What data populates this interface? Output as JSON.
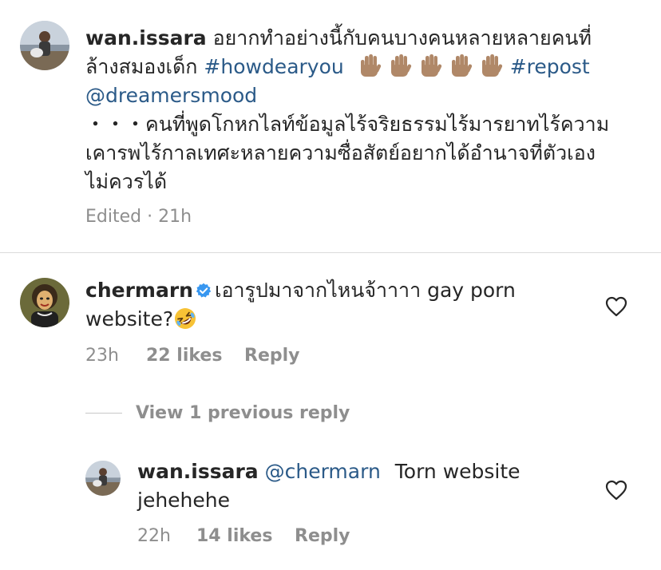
{
  "caption": {
    "username": "wan.issara",
    "text_line1": "อยากทำอย่างนี้กับคนบางคนหลายหลายคนที่",
    "text_line2_prefix": "ล้างสมองเด็ก",
    "hashtag1": "#howdearyou",
    "hand_emoji_count": 5,
    "hashtag2": "#repost",
    "mention": "@dreamersmood",
    "body_line1": "・・・คนที่พูดโกหกไลท์ข้อมูลไร้จริยธรรมไร้มารยาทไร้ความ",
    "body_line2": "เคารพไร้กาลเทศะหลายความซื่อสัตย์อยากได้อำนาจที่ตัวเอง",
    "body_line3": "ไม่ควรได้",
    "meta": "Edited · 21h"
  },
  "comment1": {
    "username": "chermarn",
    "verified": true,
    "text_line1": "เอารูปมาจากไหนจ้าาาา gay porn",
    "text_line2": "website?",
    "emoji": "rolling-on-floor-laughing",
    "time": "23h",
    "likes": "22 likes",
    "reply_label": "Reply"
  },
  "view_replies_label": "View 1 previous reply",
  "reply1": {
    "username": "wan.issara",
    "mention": "@chermarn",
    "text_line1": "Torn website",
    "text_line2": "jehehehe",
    "time": "22h",
    "likes": "14 likes",
    "reply_label": "Reply"
  },
  "colors": {
    "text": "#262626",
    "link": "#2b5a88",
    "meta": "#8e8e8e",
    "verified": "#3897f0",
    "divider": "#dbdbdb"
  }
}
